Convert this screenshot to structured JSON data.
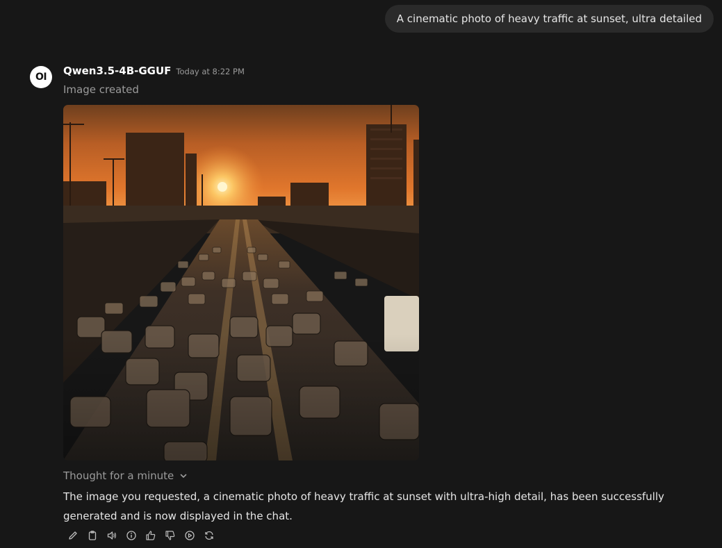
{
  "user_message": "A cinematic photo of heavy traffic at sunset, ultra detailed",
  "assistant": {
    "avatar_text": "OI",
    "model_name": "Qwen3.5-4B-GGUF",
    "timestamp": "Today at 8:22 PM",
    "status": "Image created",
    "image": {
      "subject": "cinematic heavy traffic at sunset"
    },
    "thought_label": "Thought for a minute",
    "response": "The image you requested, a cinematic photo of heavy traffic at sunset with ultra-high detail, has been successfully generated and is now displayed in the chat."
  },
  "actions": [
    {
      "name": "edit",
      "icon": "pencil-icon"
    },
    {
      "name": "copy",
      "icon": "clipboard-icon"
    },
    {
      "name": "read-aloud",
      "icon": "speaker-icon"
    },
    {
      "name": "info",
      "icon": "info-icon"
    },
    {
      "name": "good-response",
      "icon": "thumbs-up-icon"
    },
    {
      "name": "bad-response",
      "icon": "thumbs-down-icon"
    },
    {
      "name": "continue",
      "icon": "play-circle-icon"
    },
    {
      "name": "regenerate",
      "icon": "refresh-icon"
    }
  ],
  "colors": {
    "background": "#171717",
    "user_bubble": "#2a2a2a",
    "muted_text": "#9b9b9b",
    "primary_text": "#e6e6e6",
    "sky_top": "#7e4a22",
    "sky_horizon": "#e0762c",
    "sun": "#fff1b8"
  }
}
